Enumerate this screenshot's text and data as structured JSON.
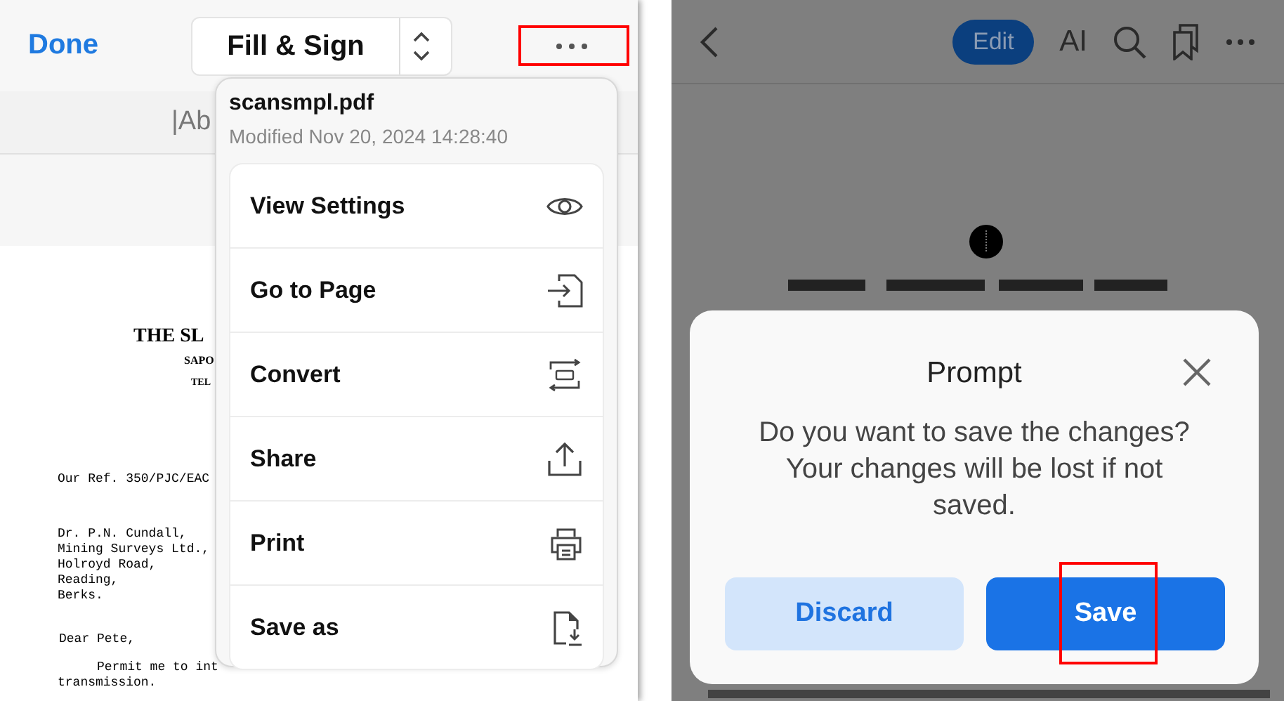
{
  "left_screen": {
    "toolbar": {
      "done_button": "Done",
      "mode_selector": "Fill & Sign",
      "more_button": {
        "highlighted": true
      }
    },
    "format_bar": {
      "text": "|Ab"
    },
    "document": {
      "heading": "THE SL",
      "subheading": "SAPO",
      "subheading_2": "TEL",
      "reference": "Our Ref. 350/PJC/EAC",
      "address": [
        "Dr. P.N. Cundall,",
        "Mining Surveys Ltd.,",
        "Holroyd Road,",
        "Reading,",
        "Berks."
      ],
      "salutation": "Dear Pete,",
      "body": [
        "Permit me to int",
        "transmission."
      ]
    },
    "menu": {
      "file_name": "scansmpl.pdf",
      "modified": "Modified Nov 20, 2024 14:28:40",
      "items": [
        {
          "label": "View Settings",
          "kind": "view"
        },
        {
          "label": "Go to Page",
          "kind": "goto"
        },
        {
          "label": "Convert",
          "kind": "convert"
        },
        {
          "label": "Share",
          "kind": "share"
        },
        {
          "label": "Print",
          "kind": "print"
        },
        {
          "label": "Save as",
          "kind": "saveas"
        }
      ]
    }
  },
  "right_screen": {
    "toolbar": {
      "edit_button": "Edit",
      "ai_button": "AI"
    },
    "dialog": {
      "title": "Prompt",
      "message": "Do you want to save the changes? Your changes will be lost if not saved.",
      "buttons": [
        {
          "label": "Discard",
          "kind": "secondary",
          "highlighted": false
        },
        {
          "label": "Save",
          "kind": "primary",
          "highlighted": true
        }
      ]
    }
  }
}
